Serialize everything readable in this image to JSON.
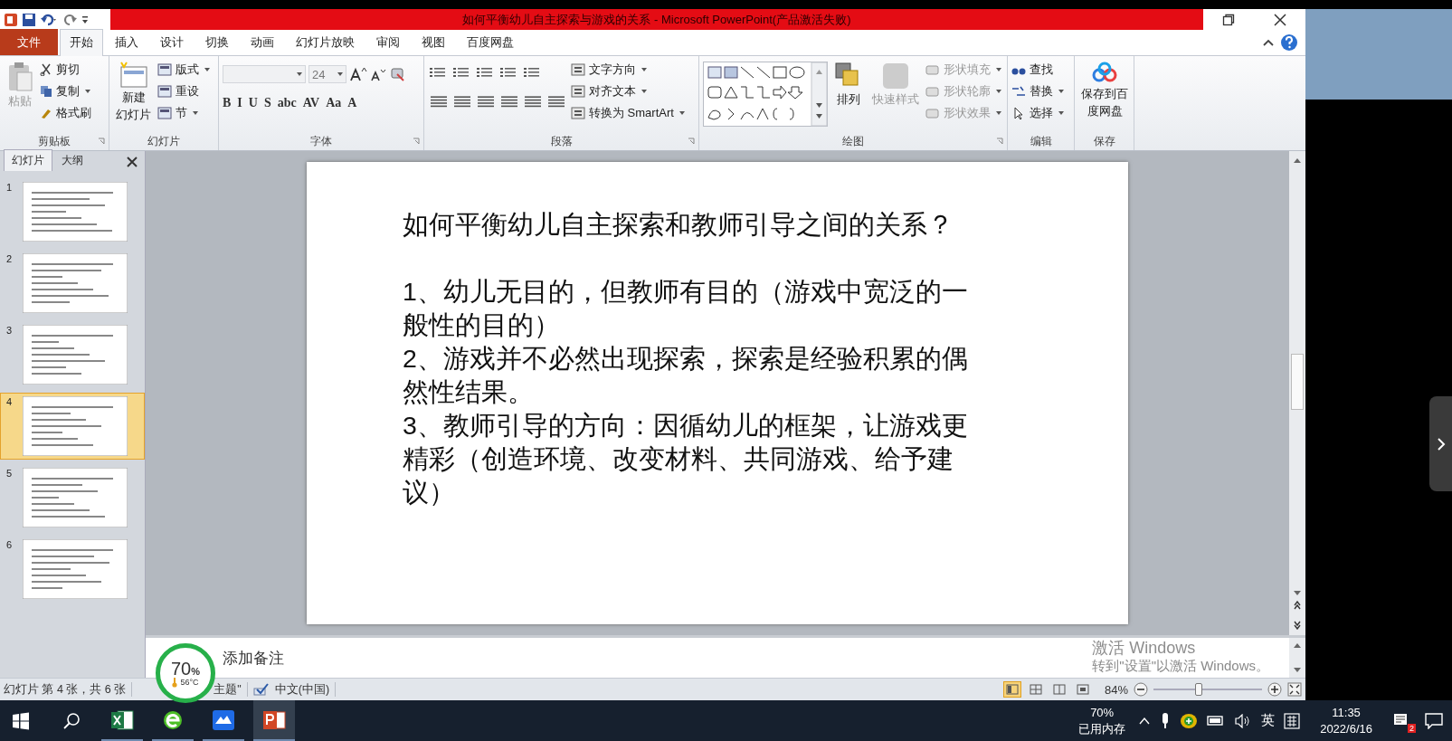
{
  "window": {
    "title": "如何平衡幼儿自主探索与游戏的关系 - Microsoft PowerPoint(产品激活失败)"
  },
  "tabs": [
    {
      "label": "文件",
      "kind": "file",
      "selected": false
    },
    {
      "label": "开始",
      "kind": "tab",
      "selected": true
    },
    {
      "label": "插入",
      "kind": "tab",
      "selected": false
    },
    {
      "label": "设计",
      "kind": "tab",
      "selected": false
    },
    {
      "label": "切换",
      "kind": "tab",
      "selected": false
    },
    {
      "label": "动画",
      "kind": "tab",
      "selected": false
    },
    {
      "label": "幻灯片放映",
      "kind": "tab",
      "selected": false
    },
    {
      "label": "审阅",
      "kind": "tab",
      "selected": false
    },
    {
      "label": "视图",
      "kind": "tab",
      "selected": false
    },
    {
      "label": "百度网盘",
      "kind": "tab",
      "selected": false
    }
  ],
  "ribbon": {
    "groups": [
      {
        "kind": "clipboard",
        "label": "剪贴板",
        "large": {
          "label": "粘贴",
          "disabled": true
        },
        "small": [
          {
            "label": "剪切",
            "disabled": false,
            "caret": false
          },
          {
            "label": "复制",
            "disabled": false,
            "caret": true
          },
          {
            "label": "格式刷",
            "disabled": false,
            "caret": false
          }
        ]
      },
      {
        "kind": "slides",
        "label": "幻灯片",
        "large": {
          "lines": [
            "新建",
            "幻灯片"
          ],
          "disabled": false
        },
        "small": [
          {
            "label": "版式",
            "disabled": false,
            "caret": true
          },
          {
            "label": "重设",
            "disabled": false,
            "caret": false
          },
          {
            "label": "节",
            "disabled": false,
            "caret": true
          }
        ]
      },
      {
        "kind": "font",
        "label": "字体",
        "size": "24",
        "format": [
          "B",
          "I",
          "U",
          "S",
          "abc",
          "AV",
          "Aa",
          "A"
        ]
      },
      {
        "kind": "paragraph",
        "label": "段落",
        "small": [
          {
            "label": "文字方向",
            "disabled": false,
            "caret": true
          },
          {
            "label": "对齐文本",
            "disabled": false,
            "caret": true
          },
          {
            "label": "转换为 SmartArt",
            "disabled": false,
            "caret": true
          }
        ]
      },
      {
        "kind": "drawing",
        "label": "绘图",
        "large": [
          {
            "label": "排列",
            "disabled": false
          },
          {
            "label": "快速样式",
            "disabled": true
          }
        ],
        "small": [
          {
            "label": "形状填充",
            "disabled": true,
            "caret": true
          },
          {
            "label": "形状轮廓",
            "disabled": true,
            "caret": true
          },
          {
            "label": "形状效果",
            "disabled": true,
            "caret": true
          }
        ]
      },
      {
        "kind": "editing",
        "label": "编辑",
        "small": [
          {
            "label": "查找",
            "disabled": false,
            "caret": false
          },
          {
            "label": "替换",
            "disabled": false,
            "caret": true
          },
          {
            "label": "选择",
            "disabled": false,
            "caret": true
          }
        ]
      },
      {
        "kind": "save",
        "label": "保存",
        "large": {
          "lines": [
            "保存到百",
            "度网盘"
          ],
          "disabled": false
        }
      }
    ]
  },
  "slide_pane": {
    "tabs": [
      {
        "label": "幻灯片",
        "selected": true
      },
      {
        "label": "大纲",
        "selected": false
      }
    ],
    "slides": [
      {
        "number": "1",
        "selected": false
      },
      {
        "number": "2",
        "selected": false
      },
      {
        "number": "3",
        "selected": false
      },
      {
        "number": "4",
        "selected": true
      },
      {
        "number": "5",
        "selected": false
      },
      {
        "number": "6",
        "selected": false
      }
    ]
  },
  "slide": {
    "title": "如何平衡幼儿自主探索和教师引导之间的关系？",
    "paragraphs": [
      "1、幼儿无目的，但教师有目的（游戏中宽泛的一般性的目的）",
      "2、游戏并不必然出现探索，探索是经验积累的偶然性结果。",
      "3、教师引导的方向：因循幼儿的框架，让游戏更精彩（创造环境、改变材料、共同游戏、给予建议）"
    ]
  },
  "notes": {
    "text": "添加备注"
  },
  "activation": {
    "title": "激活 Windows",
    "hint": "转到\"设置\"以激活 Windows。"
  },
  "gauge": {
    "percent": "70",
    "unit": "%",
    "temperature": "56°C"
  },
  "status_bar": {
    "slide_info": "幻灯片 第 4 张，共 6 张",
    "theme": "主题\"",
    "language": "中文(中国)",
    "views": [
      {
        "selected": true
      },
      {
        "selected": false
      },
      {
        "selected": false
      },
      {
        "selected": false
      }
    ],
    "zoom": "84%",
    "zoom_slider": {
      "level": 0.42
    }
  },
  "taskbar": {
    "apps": [
      {
        "kind": "excel",
        "selected": false
      },
      {
        "kind": "browser",
        "selected": false
      },
      {
        "kind": "meeting",
        "selected": false
      },
      {
        "kind": "powerpoint",
        "selected": true
      }
    ],
    "memory": "70%",
    "memory_label": "已用内存",
    "ime": "英",
    "time": "11:35",
    "date": "2022/6/16",
    "badge": "2"
  }
}
